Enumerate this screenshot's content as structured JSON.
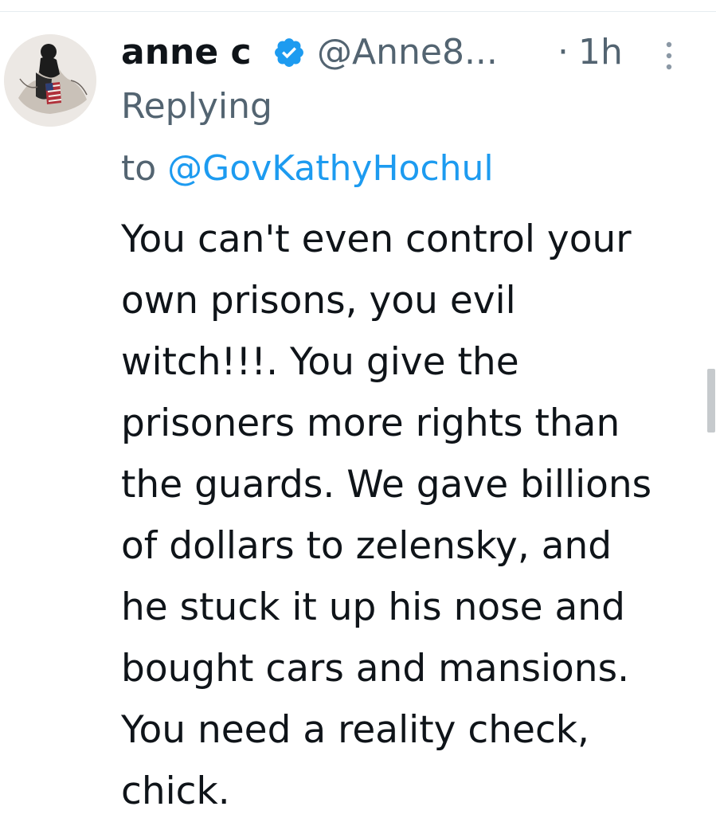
{
  "tweet": {
    "author": {
      "display_name": "anne c",
      "handle": "@Anne8...",
      "verified": true,
      "avatar_icon": "avatar-image"
    },
    "separator": "·",
    "timestamp": "1h",
    "reply": {
      "prefix": "Replying",
      "to_word": "to",
      "mention": "@GovKathyHochul"
    },
    "body_lines": [
      "You can't even control your",
      "own prisons, you evil",
      "witch!!!. You give the",
      "prisoners more rights than",
      "the guards. We gave billions",
      "of dollars to zelensky, and",
      "he stuck it up his nose and",
      "bought cars and mansions.",
      "You need a reality check,",
      "chick."
    ]
  },
  "colors": {
    "text_primary": "#0f1419",
    "text_secondary": "#536471",
    "accent": "#1d9bf0",
    "divider": "#e6ecf0",
    "scrollbar": "#c6cacd"
  },
  "icons": {
    "verified": "verified-badge-icon",
    "more": "more-options-icon"
  }
}
